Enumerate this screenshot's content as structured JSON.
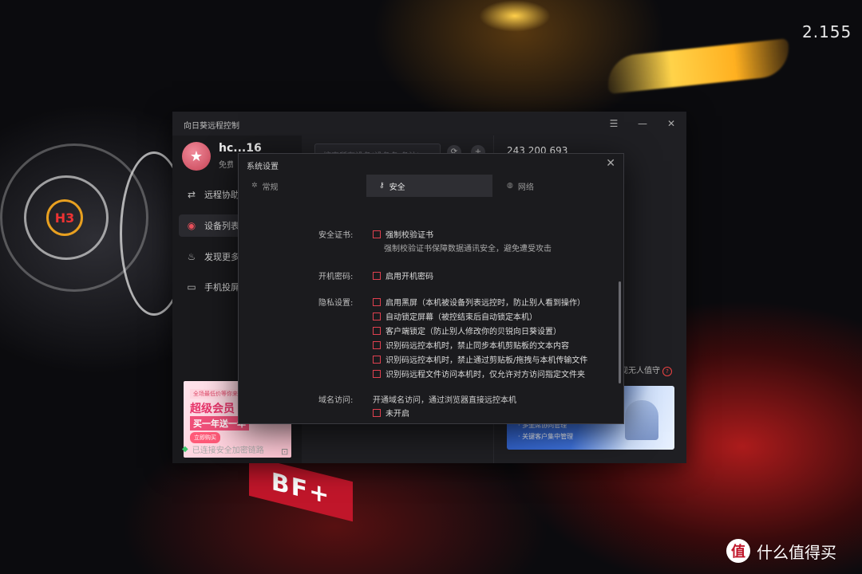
{
  "background": {
    "hud_value": "2.155",
    "bf_label": "BF+",
    "badge_label": "H3",
    "watermark_logo": "值",
    "watermark_text": "什么值得买"
  },
  "app": {
    "title": "向日葵远程控制",
    "window_controls": {
      "menu": "☰",
      "minimize": "—",
      "close": "✕"
    },
    "user": {
      "name": "hc...16",
      "sub": "免费版"
    },
    "nav": [
      {
        "label": "远程协助",
        "icon": "remote-assist-icon"
      },
      {
        "label": "设备列表",
        "icon": "device-list-icon"
      },
      {
        "label": "发现更多",
        "icon": "discover-icon"
      },
      {
        "label": "手机投屏",
        "icon": "screen-cast-icon"
      }
    ],
    "ad": {
      "tag": "全场最低价等你来领",
      "title": "超级会员",
      "sub": "买一年送一年",
      "button": "立即购买"
    },
    "connection_status": "已连接安全加密链路",
    "search_placeholder": "搜索所有设备(设备名/备注)",
    "device_id": "243 200 693",
    "unattended": "现无人值守",
    "promo": {
      "line1": "· 多坐席协同管理",
      "line2": "· 关键客户集中管理"
    }
  },
  "dialog": {
    "title": "系统设置",
    "close": "✕",
    "tabs": [
      {
        "label": "常规",
        "icon": "gear-icon"
      },
      {
        "label": "安全",
        "icon": "key-icon"
      },
      {
        "label": "网络",
        "icon": "globe-icon"
      }
    ],
    "sections": {
      "cert_label": "安全证书:",
      "cert_option": "强制校验证书",
      "cert_desc": "强制校验证书保障数据通讯安全，避免遭受攻击",
      "boot_label": "开机密码:",
      "boot_option": "启用开机密码",
      "privacy_label": "隐私设置:",
      "privacy_options": [
        "启用黑屏（本机被设备列表远控时，防止别人看到操作）",
        "自动锁定屏幕（被控结束后自动锁定本机）",
        "客户端锁定（防止别人修改你的贝锐向日葵设置）",
        "识别码远控本机时，禁止同步本机剪贴板的文本内容",
        "识别码远控本机时，禁止通过剪贴板/拖拽与本机传输文件",
        "识别码远程文件访问本机时，仅允许对方访问指定文件夹"
      ],
      "domain_label": "域名访问:",
      "domain_desc": "开通域名访问，通过浏览器直接远控本机",
      "domain_option": "未开启"
    }
  },
  "colors": {
    "accent": "#e0404f",
    "ok": "#3cc46a",
    "panel": "#1f1f23"
  }
}
